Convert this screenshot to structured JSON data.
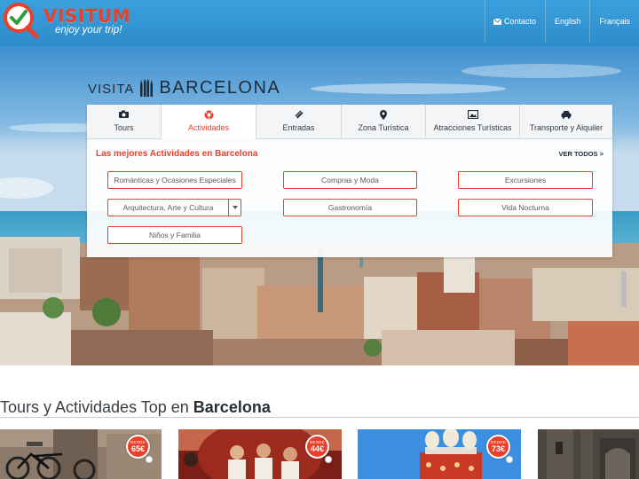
{
  "header": {
    "brand": "VISITUM",
    "tagline": "enjoy your trip!",
    "nav": [
      {
        "label": "Contacto",
        "icon": "envelope-icon"
      },
      {
        "label": "English"
      },
      {
        "label": "Français"
      }
    ]
  },
  "hero": {
    "title_prefix": "VISITA",
    "title_city": "BARCELONA",
    "city_icon": "sagrada-familia-icon"
  },
  "search_panel": {
    "tabs": [
      {
        "label": "Tours",
        "icon": "camera-icon",
        "active": false
      },
      {
        "label": "Actividades",
        "icon": "ball-icon",
        "active": true
      },
      {
        "label": "Entradas",
        "icon": "ticket-icon",
        "active": false
      },
      {
        "label": "Zona Turística",
        "icon": "map-pin-icon",
        "active": false
      },
      {
        "label": "Atracciones Turísticas",
        "icon": "photo-icon",
        "active": false
      },
      {
        "label": "Transporte y Alquiler",
        "icon": "car-icon",
        "active": false
      }
    ],
    "heading": "Las mejores Actividades en Barcelona",
    "see_all": "VER TODOS >",
    "categories": [
      "Románticas y Ocasiones Especiales",
      "Compras y Moda",
      "Excursiones",
      "Arquitectura, Arte y Cultura",
      "Gastronomía",
      "Vida Nocturna",
      "Niños y Familia"
    ]
  },
  "tours_section": {
    "title_prefix": "Tours y Actividades Top en ",
    "title_city": "Barcelona",
    "cards": [
      {
        "desde": "DESDE",
        "price": "65€",
        "image": "bicycle-tour-photo"
      },
      {
        "desde": "DESDE",
        "price": "44€",
        "image": "flamenco-dancers-photo"
      },
      {
        "desde": "DESDE",
        "price": "73€",
        "image": "dali-museum-photo"
      },
      {
        "image": "gothic-quarter-photo"
      }
    ]
  },
  "colors": {
    "accent": "#e8402a",
    "header_blue": "#2e8ccb",
    "text_dark": "#1f2b3a"
  }
}
